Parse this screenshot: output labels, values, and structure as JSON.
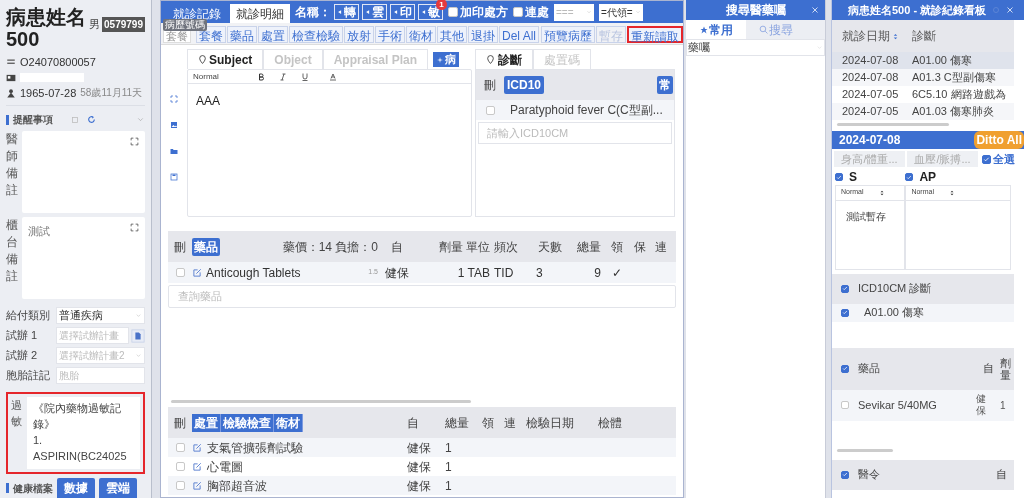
{
  "patient": {
    "name": "病患姓名500",
    "sex": "男",
    "chart_no": "0579799",
    "record_no": "O24070800057",
    "birth": "1965-07-28",
    "age": "58歲11月11天"
  },
  "reminders": {
    "title": "提醒事項",
    "notes": [
      {
        "label": "醫師備註"
      },
      {
        "label": "櫃台備註",
        "value": "測試"
      }
    ]
  },
  "form_fields": [
    {
      "label": "給付類別",
      "value": "普通疾病",
      "kind": "select"
    },
    {
      "label": "試辦 1",
      "placeholder": "選擇試辦計畫",
      "kind": "picker"
    },
    {
      "label": "試辦 2",
      "placeholder": "選擇試辦計畫2",
      "kind": "select"
    },
    {
      "label": "胞胎註記",
      "placeholder": "胞胎",
      "kind": "input"
    }
  ],
  "allergy": {
    "label": "過敏",
    "lines": [
      "《院內藥物過敏記錄》",
      "1.",
      "ASPIRIN(BC24025"
    ],
    "highlighted": true
  },
  "health_record": {
    "label": "健康檔案",
    "buttons": [
      "數據",
      "雲端"
    ]
  },
  "main_tabs": [
    {
      "label": "就診記錄",
      "selected": false
    },
    {
      "label": "就診明細",
      "selected": true
    }
  ],
  "name_label": "名稱：",
  "tool_buttons": [
    {
      "label": "轉"
    },
    {
      "label": "雲"
    },
    {
      "label": "印"
    },
    {
      "label": "敏",
      "badge": "1"
    }
  ],
  "options": [
    {
      "label": "加印處方",
      "checked": false
    },
    {
      "label": "連處",
      "checked": false
    }
  ],
  "selects": [
    "===",
    "=代領="
  ],
  "tooltip": "病歷號碼",
  "order_search": {
    "placeholder": "套餐"
  },
  "order_buttons": [
    {
      "label": "套餐"
    },
    {
      "label": "藥品"
    },
    {
      "label": "處置"
    },
    {
      "label": "檢查檢驗"
    },
    {
      "label": "放射"
    },
    {
      "label": "手術"
    },
    {
      "label": "衛材"
    },
    {
      "label": "其他"
    },
    {
      "label": "退掛"
    },
    {
      "label": "Del All"
    }
  ],
  "record_buttons": [
    {
      "label": "預覽病歷",
      "disabled": false,
      "highlighted": false
    },
    {
      "label": "暫存",
      "disabled": true,
      "highlighted": false
    },
    {
      "label": "重新讀取",
      "disabled": false,
      "highlighted": true
    }
  ],
  "soap_tabs": [
    {
      "label": "Subject",
      "selected": true
    },
    {
      "label": "Object",
      "selected": false
    },
    {
      "label": "Appraisal Plan",
      "selected": false
    }
  ],
  "history_button": "病",
  "editor": {
    "format": "Normal",
    "text": "AAA"
  },
  "diagnosis": {
    "tabs": [
      {
        "label": "診斷",
        "selected": true
      },
      {
        "label": "處置碼",
        "selected": false
      }
    ],
    "delete_label": "刪",
    "code_label": "ICD10",
    "common_label": "常",
    "rows": [
      {
        "text": "Paratyphoid fever C(C型副...",
        "checked": false
      }
    ],
    "placeholder": "請輸入ICD10CM"
  },
  "drugs": {
    "delete_label": "刪",
    "tab": "藥品",
    "summary": "藥價：14 負擔：0",
    "columns": [
      "自",
      "劑量 單位",
      "頻次",
      "天數",
      "總量",
      "領",
      "保",
      "連"
    ],
    "rows": [
      {
        "name": "Anticough Tablets",
        "note": "1.5",
        "payer": "健保",
        "dose": "1 TAB",
        "freq": "TID",
        "days": "3",
        "total": "9",
        "dispense": "✓",
        "checked": false
      }
    ],
    "placeholder": "查詢藥品"
  },
  "orders": {
    "delete_label": "刪",
    "tabs": [
      "處置",
      "檢驗檢查",
      "衛材"
    ],
    "columns": [
      "自",
      "總量",
      "領",
      "連",
      "檢驗日期",
      "檢體"
    ],
    "rows": [
      {
        "name": "支氣管擴張劑試驗",
        "payer": "健保",
        "total": "1",
        "checked": false
      },
      {
        "name": "心電圖",
        "payer": "健保",
        "total": "1",
        "checked": false
      },
      {
        "name": "胸部超音波",
        "payer": "健保",
        "total": "1",
        "checked": false
      }
    ]
  },
  "search_panel": {
    "title": "搜尋醫藥囑",
    "tabs": [
      {
        "label": "常用",
        "selected": true
      },
      {
        "label": "搜尋",
        "selected": false
      }
    ],
    "select": "藥囑"
  },
  "history_panel": {
    "title": "病患姓名500 - 就診紀錄看板",
    "columns": [
      "就診日期",
      "診斷"
    ],
    "rows": [
      {
        "date": "2024-07-08",
        "diagnosis": "A01.00 傷寒",
        "selected": true
      },
      {
        "date": "2024-07-08",
        "diagnosis": "A01.3 C型副傷寒",
        "selected": false
      },
      {
        "date": "2024-07-05",
        "diagnosis": "6C5.10 網路遊戲為",
        "selected": false
      },
      {
        "date": "2024-07-05",
        "diagnosis": "A01.03 傷寒肺炎",
        "selected": false
      }
    ],
    "detail_date": "2024-07-08",
    "ditto": "Ditto All",
    "vital_buttons": [
      "身高/體重...",
      "血壓/脈搏..."
    ],
    "select_all": {
      "label": "全選",
      "checked": true
    },
    "soap": [
      {
        "label": "S",
        "checked": true,
        "format": "Normal",
        "text": "測試暫存"
      },
      {
        "label": "AP",
        "checked": true,
        "format": "Normal"
      }
    ],
    "icd": {
      "title": "ICD10CM 診斷",
      "checked": true,
      "rows": [
        {
          "text": "A01.00 傷寒",
          "checked": true
        }
      ]
    },
    "drugs": {
      "title": "藥品",
      "checked": true,
      "columns": [
        "自",
        "劑量"
      ],
      "rows": [
        {
          "name": "Sevikar 5/40MG",
          "payer": "健保",
          "dose": "1",
          "checked": false
        }
      ]
    },
    "orders": {
      "title": "醫令",
      "checked": true,
      "columns": [
        "自"
      ]
    }
  }
}
